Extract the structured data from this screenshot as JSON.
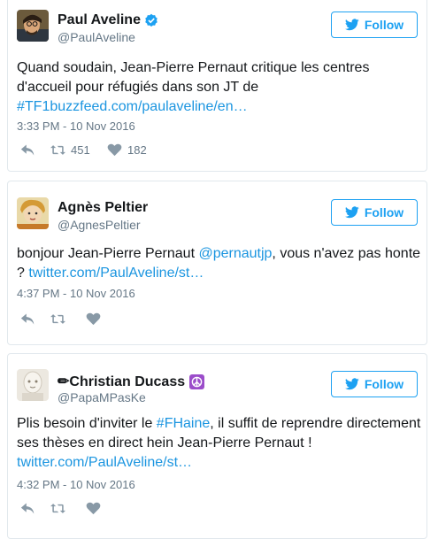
{
  "tweets": [
    {
      "name": "Paul Aveline",
      "handle": "@PaulAveline",
      "follow_label": "Follow",
      "text_before": "Quand soudain, Jean-Pierre Pernaut critique les centres d'accueil pour réfugiés dans son JT de ",
      "link": "#TF1buzzfeed.com/paulaveline/en…",
      "timestamp": "3:33 PM - 10 Nov 2016",
      "retweets": "451",
      "likes": "182"
    },
    {
      "name": "Agnès Peltier",
      "handle": "@AgnesPeltier",
      "follow_label": "Follow",
      "text_before": "bonjour Jean-Pierre Pernaut ",
      "mention": "@pernautjp",
      "text_after": ", vous n'avez pas honte ? ",
      "link": "twitter.com/PaulAveline/st…",
      "timestamp": "4:37 PM - 10 Nov 2016"
    },
    {
      "name": "✏Christian Ducass",
      "handle": "@PapaMPasKe",
      "follow_label": "Follow",
      "text_before": "Plis besoin d'inviter le ",
      "hashtag": "#FHaine",
      "text_after": ", il suffit de reprendre directement ses thèses en direct hein Jean-Pierre Pernaut ! ",
      "link": "twitter.com/PaulAveline/st…",
      "timestamp": "4:32 PM - 10 Nov 2016"
    }
  ],
  "icons": {
    "verified": "verified-badge-icon",
    "bird": "twitter-bird-icon",
    "reply": "reply-icon",
    "retweet": "retweet-icon",
    "like": "heart-icon",
    "peace": "peace-sign-icon"
  },
  "colors": {
    "accent": "#1da1f2",
    "link": "#1b95e0",
    "muted": "#657786",
    "border": "#e1e8ed"
  }
}
